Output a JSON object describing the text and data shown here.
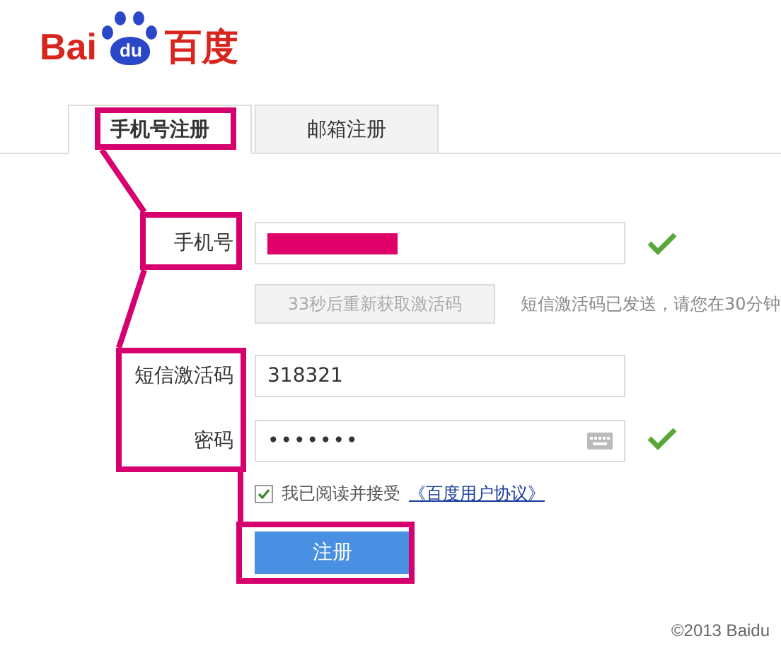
{
  "logo": {
    "left": "Bai",
    "paw": "du",
    "right": "百度"
  },
  "tabs": [
    {
      "label": "手机号注册",
      "selected": true
    },
    {
      "label": "邮箱注册",
      "selected": false
    }
  ],
  "form": {
    "phone": {
      "label": "手机号",
      "redacted": true,
      "valid": true
    },
    "resend_button": {
      "label": "33秒后重新获取激活码",
      "disabled": true
    },
    "sms_hint": "短信激活码已发送，请您在30分钟",
    "sms_code": {
      "label": "短信激活码",
      "value": "318321"
    },
    "password": {
      "label": "密码",
      "value": "•••••••",
      "valid": true
    },
    "agreement": {
      "checked": true,
      "text": "我已阅读并接受",
      "link": "《百度用户协议》"
    },
    "submit": "注册"
  },
  "footer": "©2013 Baidu"
}
